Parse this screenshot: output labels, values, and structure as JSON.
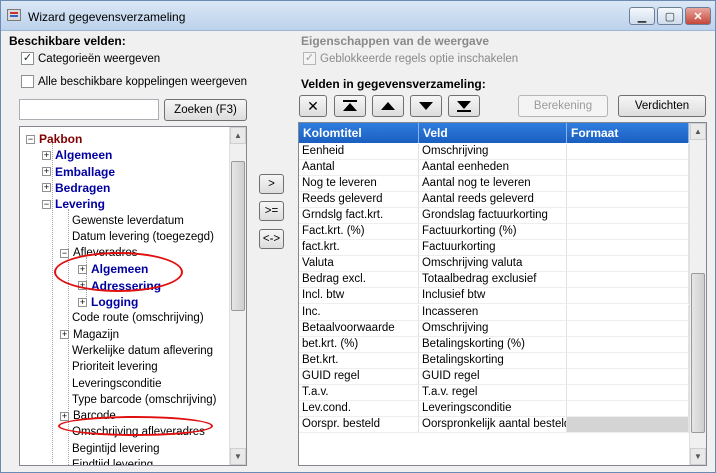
{
  "window": {
    "title": "Wizard gegevensverzameling"
  },
  "left": {
    "heading": "Beschikbare velden:",
    "checkbox_categories": {
      "label": "Categorieën weergeven",
      "checked": true
    },
    "checkbox_all_links": {
      "label": "Alle beschikbare koppelingen weergeven",
      "checked": false
    },
    "search": {
      "value": "",
      "placeholder": ""
    },
    "search_button": "Zoeken (F3)",
    "tree": [
      {
        "label": "Pakbon",
        "kind": "root",
        "expander": "minus"
      },
      {
        "label": "Algemeen",
        "kind": "bold",
        "expander": "plus"
      },
      {
        "label": "Emballage",
        "kind": "bold",
        "expander": "plus"
      },
      {
        "label": "Bedragen",
        "kind": "bold",
        "expander": "plus"
      },
      {
        "label": "Levering",
        "kind": "bold",
        "expander": "minus"
      },
      {
        "label": "Gewenste leverdatum",
        "kind": "normal",
        "expander": ""
      },
      {
        "label": "Datum levering (toegezegd)",
        "kind": "normal",
        "expander": ""
      },
      {
        "label": "Afleveradres",
        "kind": "normal",
        "expander": "minus"
      },
      {
        "label": "Algemeen",
        "kind": "bold",
        "expander": "plus"
      },
      {
        "label": "Adressering",
        "kind": "bold",
        "expander": "plus"
      },
      {
        "label": "Logging",
        "kind": "bold",
        "expander": "plus"
      },
      {
        "label": "Code route (omschrijving)",
        "kind": "normal",
        "expander": ""
      },
      {
        "label": "Magazijn",
        "kind": "normal",
        "expander": "plus"
      },
      {
        "label": "Werkelijke datum aflevering",
        "kind": "normal",
        "expander": ""
      },
      {
        "label": "Prioriteit levering",
        "kind": "normal",
        "expander": ""
      },
      {
        "label": "Leveringsconditie",
        "kind": "normal",
        "expander": ""
      },
      {
        "label": "Type barcode (omschrijving)",
        "kind": "normal",
        "expander": ""
      },
      {
        "label": "Barcode",
        "kind": "normal",
        "expander": "plus"
      },
      {
        "label": "Omschrijving afleveradres",
        "kind": "normal",
        "expander": ""
      },
      {
        "label": "Begintijd levering",
        "kind": "normal",
        "expander": ""
      },
      {
        "label": "Eindtijd levering",
        "kind": "normal",
        "expander": ""
      }
    ]
  },
  "middle_buttons": {
    "add": ">",
    "add_all": ">=",
    "swap": "<->"
  },
  "right": {
    "props_heading": "Eigenschappen van de weergave",
    "checkbox_blocked": {
      "label": "Geblokkeerde regels optie inschakelen",
      "checked": true
    },
    "fields_heading": "Velden in gegevensverzameling:",
    "toolbar": {
      "delete": "✕",
      "move_top": "top",
      "move_up": "up",
      "move_down": "down",
      "move_bottom": "bottom"
    },
    "calc_button": "Berekening",
    "collapse_button": "Verdichten",
    "columns": [
      "Kolomtitel",
      "Veld",
      "Formaat"
    ],
    "rows": [
      [
        "Eenheid",
        "Omschrijving",
        ""
      ],
      [
        "Aantal",
        "Aantal eenheden",
        ""
      ],
      [
        "Nog te leveren",
        "Aantal nog te leveren",
        ""
      ],
      [
        "Reeds geleverd",
        "Aantal reeds geleverd",
        ""
      ],
      [
        "Grndslg fact.krt.",
        "Grondslag factuurkorting",
        ""
      ],
      [
        "Fact.krt. (%)",
        "Factuurkorting (%)",
        ""
      ],
      [
        "fact.krt.",
        "Factuurkorting",
        ""
      ],
      [
        "Valuta",
        "Omschrijving valuta",
        ""
      ],
      [
        "Bedrag excl.",
        "Totaalbedrag exclusief",
        ""
      ],
      [
        "Incl. btw",
        "Inclusief btw",
        ""
      ],
      [
        "Inc.",
        "Incasseren",
        ""
      ],
      [
        "Betaalvoorwaarde",
        "Omschrijving",
        ""
      ],
      [
        "bet.krt. (%)",
        "Betalingskorting (%)",
        ""
      ],
      [
        "Bet.krt.",
        "Betalingskorting",
        ""
      ],
      [
        "GUID regel",
        "GUID regel",
        ""
      ],
      [
        "T.a.v.",
        "T.a.v. regel",
        ""
      ],
      [
        "Lev.cond.",
        "Leveringsconditie",
        ""
      ],
      [
        "Oorspr. besteld",
        "Oorspronkelijk aantal besteld",
        ""
      ]
    ]
  },
  "colors": {
    "grid_header": "#2f7de0",
    "highlight": "#e01010",
    "tree_bold": "#0000a0",
    "tree_root": "#800000"
  }
}
